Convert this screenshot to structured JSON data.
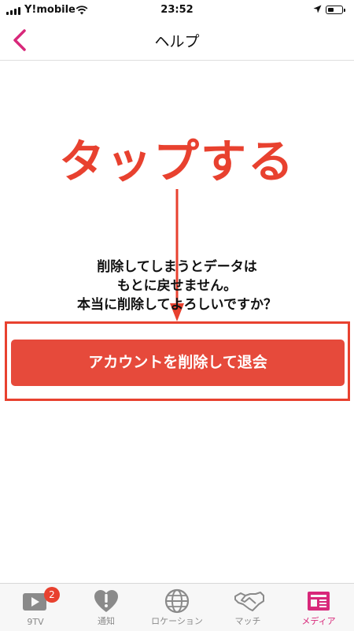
{
  "status_bar": {
    "carrier": "Y!mobile",
    "time": "23:52",
    "battery_level": 0.45
  },
  "nav": {
    "title": "ヘルプ",
    "back_icon": "chevron-left-icon"
  },
  "annotation": {
    "text": "タップする",
    "color": "#e8412f"
  },
  "message": {
    "lines": [
      "削除してしまうとデータは",
      "もとに戻せません。",
      "本当に削除してよろしいですか？"
    ]
  },
  "withdraw_button": {
    "label": "アカウントを削除して退会",
    "color": "#e64a3b"
  },
  "tab_bar": {
    "active_color": "#d8287a",
    "items": [
      {
        "label": "9TV",
        "icon": "play-icon",
        "badge": "2"
      },
      {
        "label": "通知",
        "icon": "heart-exclamation-icon"
      },
      {
        "label": "ロケーション",
        "icon": "globe-icon"
      },
      {
        "label": "マッチ",
        "icon": "handshake-icon"
      },
      {
        "label": "メディア",
        "icon": "newspaper-icon",
        "active": true
      }
    ]
  }
}
